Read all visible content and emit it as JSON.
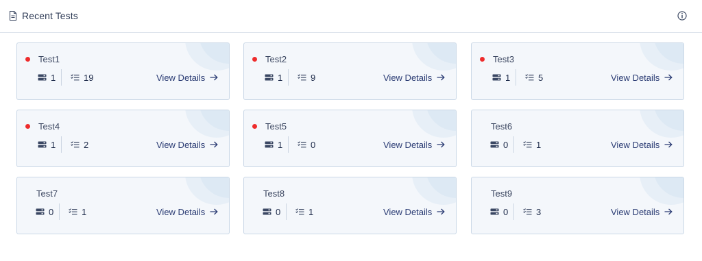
{
  "panel": {
    "title": "Recent Tests",
    "header_icon": "document-icon",
    "info_icon": "info-icon"
  },
  "view_details_label": "View Details",
  "colors": {
    "status_dot": "#ee2c2c",
    "card_bg": "#f4f7fb",
    "card_border": "#c9d7e6",
    "link": "#2a3b73"
  },
  "tests": [
    {
      "name": "Test1",
      "status_dot": true,
      "servers": "1",
      "checks": "19"
    },
    {
      "name": "Test2",
      "status_dot": true,
      "servers": "1",
      "checks": "9"
    },
    {
      "name": "Test3",
      "status_dot": true,
      "servers": "1",
      "checks": "5"
    },
    {
      "name": "Test4",
      "status_dot": true,
      "servers": "1",
      "checks": "2"
    },
    {
      "name": "Test5",
      "status_dot": true,
      "servers": "1",
      "checks": "0"
    },
    {
      "name": "Test6",
      "status_dot": false,
      "servers": "0",
      "checks": "1"
    },
    {
      "name": "Test7",
      "status_dot": false,
      "servers": "0",
      "checks": "1"
    },
    {
      "name": "Test8",
      "status_dot": false,
      "servers": "0",
      "checks": "1"
    },
    {
      "name": "Test9",
      "status_dot": false,
      "servers": "0",
      "checks": "3"
    }
  ]
}
